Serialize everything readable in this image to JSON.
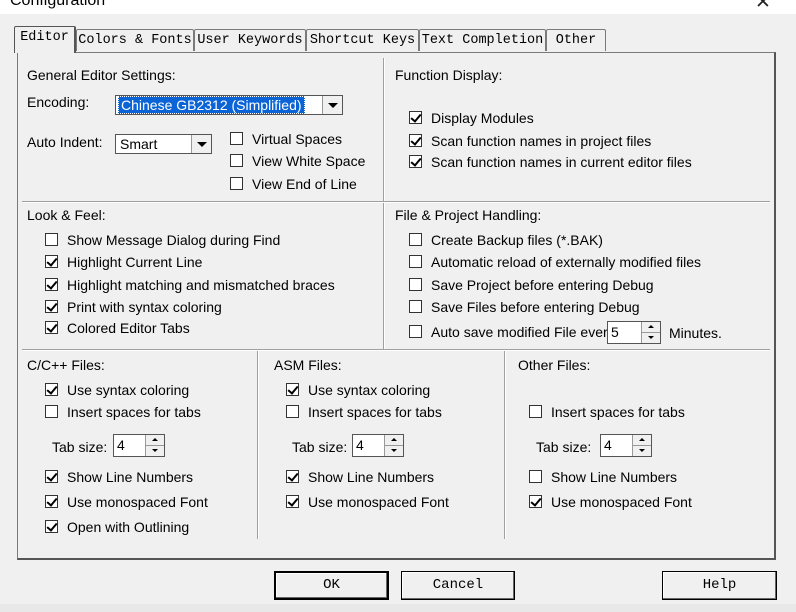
{
  "window": {
    "title": "Configuration",
    "close_glyph": "✕"
  },
  "tabs": [
    "Editor",
    "Colors & Fonts",
    "User Keywords",
    "Shortcut Keys",
    "Text Completion",
    "Other"
  ],
  "general": {
    "heading": "General Editor Settings:",
    "encoding_label": "Encoding:",
    "encoding_value": "Chinese GB2312 (Simplified)",
    "auto_indent_label": "Auto Indent:",
    "auto_indent_value": "Smart",
    "options": [
      {
        "label": "Virtual Spaces",
        "checked": false
      },
      {
        "label": "View White Space",
        "checked": false
      },
      {
        "label": "View End of Line",
        "checked": false
      }
    ]
  },
  "function_display": {
    "heading": "Function Display:",
    "options": [
      {
        "label": "Display Modules",
        "checked": true
      },
      {
        "label": "Scan function names in project files",
        "checked": true
      },
      {
        "label": "Scan function names in current editor files",
        "checked": true
      }
    ]
  },
  "look_feel": {
    "heading": "Look & Feel:",
    "options": [
      {
        "label": "Show Message Dialog during Find",
        "checked": false
      },
      {
        "label": "Highlight Current Line",
        "checked": true
      },
      {
        "label": "Highlight matching and mismatched braces",
        "checked": true
      },
      {
        "label": "Print with syntax coloring",
        "checked": true
      },
      {
        "label": "Colored Editor Tabs",
        "checked": true
      }
    ]
  },
  "file_project": {
    "heading": "File & Project Handling:",
    "options": [
      {
        "label": "Create Backup files (*.BAK)",
        "checked": false
      },
      {
        "label": "Automatic reload of externally modified files",
        "checked": false
      },
      {
        "label": "Save Project before entering Debug",
        "checked": false
      },
      {
        "label": "Save Files before entering Debug",
        "checked": false
      },
      {
        "label": "Auto save modified File every",
        "checked": false
      }
    ],
    "autosave_value": "5",
    "autosave_unit": "Minutes."
  },
  "cpp_files": {
    "heading": "C/C++ Files:",
    "syntax": {
      "label": "Use syntax coloring",
      "checked": true
    },
    "spaces": {
      "label": "Insert spaces for tabs",
      "checked": false
    },
    "tab_size_label": "Tab size:",
    "tab_size": "4",
    "line_numbers": {
      "label": "Show Line Numbers",
      "checked": true
    },
    "mono": {
      "label": "Use monospaced Font",
      "checked": true
    },
    "outlining": {
      "label": "Open with Outlining",
      "checked": true
    }
  },
  "asm_files": {
    "heading": "ASM Files:",
    "syntax": {
      "label": "Use syntax coloring",
      "checked": true
    },
    "spaces": {
      "label": "Insert spaces for tabs",
      "checked": false
    },
    "tab_size_label": "Tab size:",
    "tab_size": "4",
    "line_numbers": {
      "label": "Show Line Numbers",
      "checked": true
    },
    "mono": {
      "label": "Use monospaced Font",
      "checked": true
    }
  },
  "other_files": {
    "heading": "Other Files:",
    "spaces": {
      "label": "Insert spaces for tabs",
      "checked": false
    },
    "tab_size_label": "Tab size:",
    "tab_size": "4",
    "line_numbers": {
      "label": "Show Line Numbers",
      "checked": false
    },
    "mono": {
      "label": "Use monospaced Font",
      "checked": true
    }
  },
  "buttons": {
    "ok": "OK",
    "cancel": "Cancel",
    "help": "Help"
  }
}
